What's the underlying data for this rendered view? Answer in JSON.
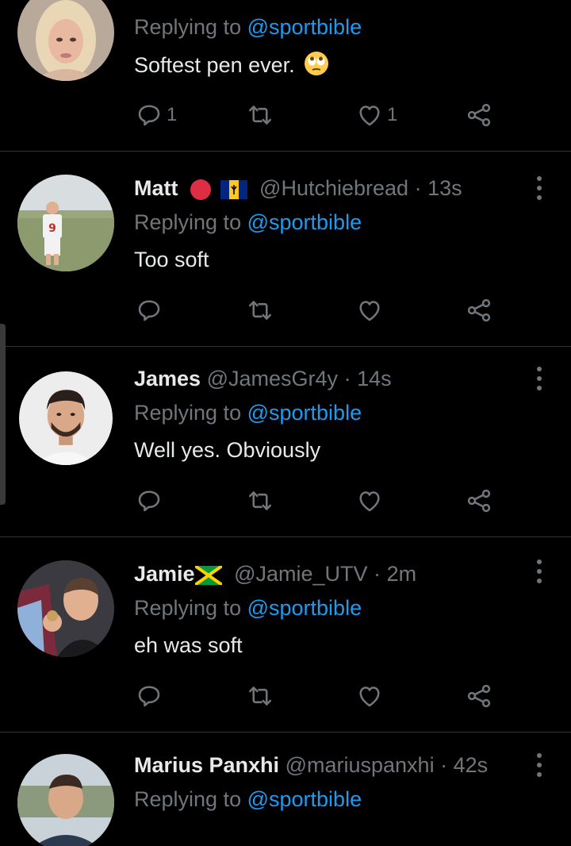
{
  "tweets": [
    {
      "name": "",
      "handle": "",
      "time": "",
      "reply_prefix": "Replying to",
      "reply_to": "@sportbible",
      "text": "Softest pen ever.",
      "emoji": "face-with-rolling-eyes",
      "replies_count": "1",
      "likes_count": "1"
    },
    {
      "name": "Matt",
      "handle": "@Hutchiebread",
      "time": "13s",
      "flags": [
        "red-circle",
        "barbados-flag"
      ],
      "reply_prefix": "Replying to",
      "reply_to": "@sportbible",
      "text": "Too soft"
    },
    {
      "name": "James",
      "handle": "@JamesGr4y",
      "time": "14s",
      "reply_prefix": "Replying to",
      "reply_to": "@sportbible",
      "text": "Well yes. Obviously"
    },
    {
      "name": "Jamie",
      "handle": "@Jamie_UTV",
      "time": "2m",
      "flags": [
        "jamaica-flag"
      ],
      "reply_prefix": "Replying to",
      "reply_to": "@sportbible",
      "text": "eh was soft"
    },
    {
      "name": "Marius Panxhi",
      "handle": "@mariuspanxhi",
      "time": "42s",
      "reply_prefix": "Replying to",
      "reply_to": "@sportbible",
      "text": ""
    }
  ],
  "separator": "·",
  "colors": {
    "background": "#000000",
    "primary_text": "#e7e9ea",
    "secondary_text": "#71767b",
    "link": "#1d9bf0",
    "divider": "#2f3336"
  }
}
